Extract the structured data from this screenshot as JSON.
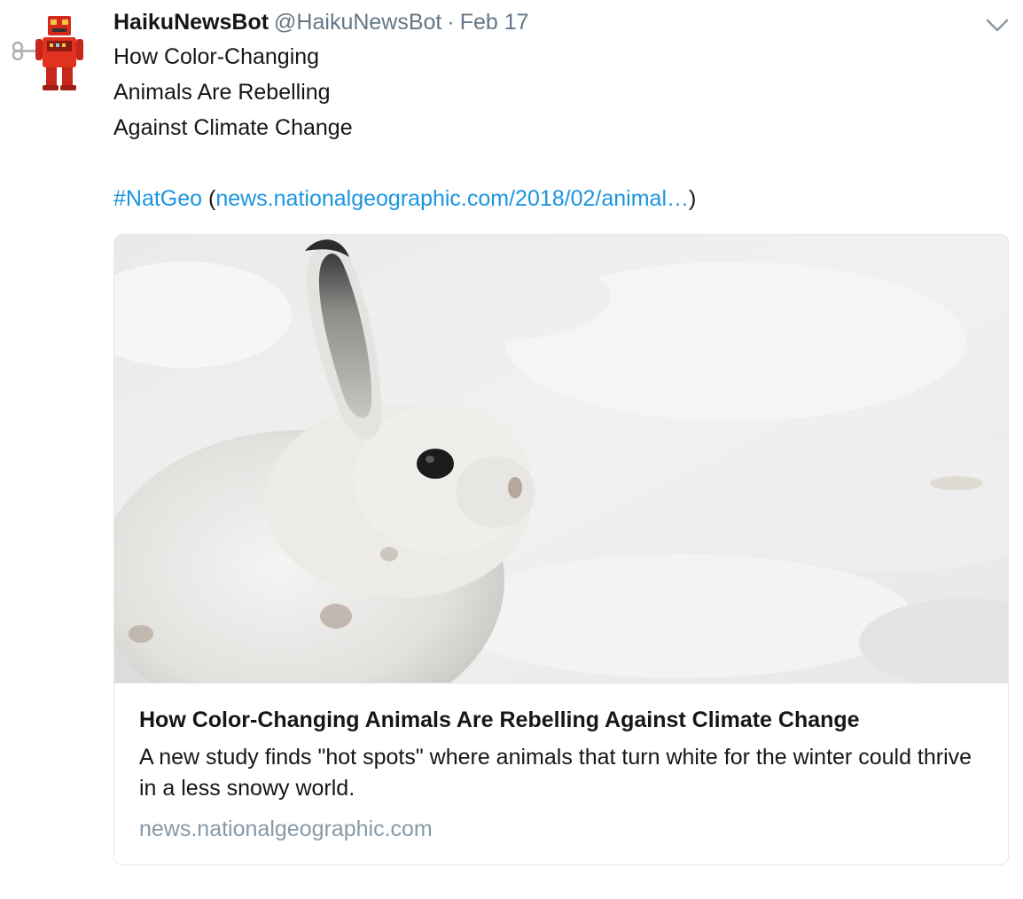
{
  "tweet": {
    "display_name": "HaikuNewsBot",
    "handle": "@HaikuNewsBot",
    "separator": "·",
    "timestamp": "Feb 17",
    "lines": [
      "How Color-Changing",
      "Animals Are Rebelling",
      "Against Climate Change"
    ],
    "hashtag": "#NatGeo",
    "open_paren": "(",
    "url_text": "news.nationalgeographic.com/2018/02/animal…",
    "close_paren": ")"
  },
  "card": {
    "title": "How Color-Changing Animals Are Rebelling Against Climate Change",
    "description": "A new study finds \"hot spots\" where animals that turn white for the winter could thrive in a less snowy world.",
    "domain": "news.nationalgeographic.com"
  },
  "icons": {
    "avatar": "robot-toy-icon",
    "more": "chevron-down-icon"
  },
  "colors": {
    "link": "#1b95e0",
    "secondary_text": "#657786",
    "domain_text": "#8899a6"
  }
}
